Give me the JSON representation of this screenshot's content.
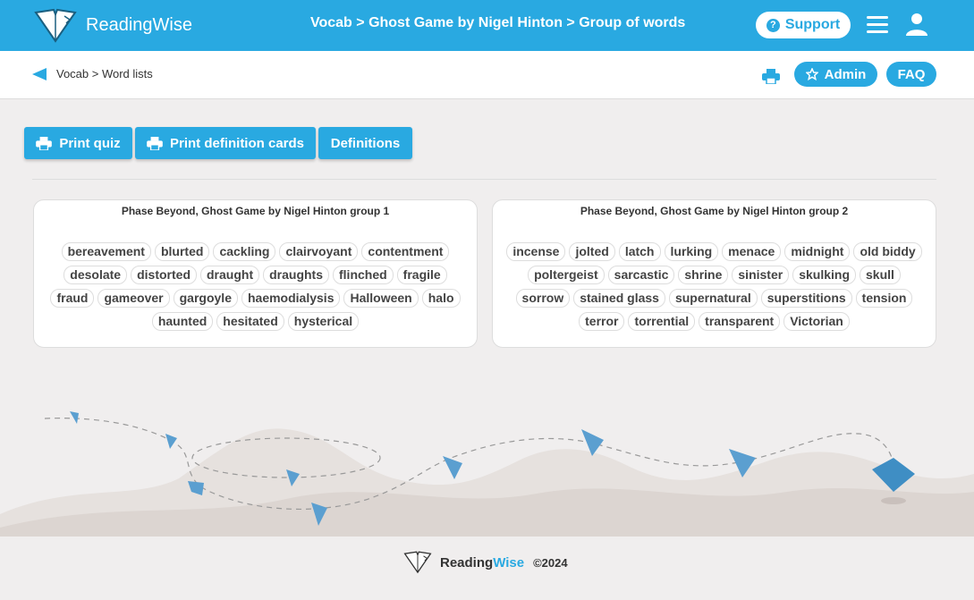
{
  "header": {
    "brand": "ReadingWise",
    "breadcrumb": "Vocab > Ghost Game by Nigel Hinton > Group of words",
    "support_label": "Support"
  },
  "subbar": {
    "breadcrumb": "Vocab > Word lists",
    "admin_label": "Admin",
    "faq_label": "FAQ"
  },
  "actions": {
    "print_quiz": "Print quiz",
    "print_cards": "Print definition cards",
    "definitions": "Definitions"
  },
  "groups": [
    {
      "title": "Phase Beyond, Ghost Game by Nigel Hinton group 1",
      "words": [
        "bereavement",
        "blurted",
        "cackling",
        "clairvoyant",
        "contentment",
        "desolate",
        "distorted",
        "draught",
        "draughts",
        "flinched",
        "fragile",
        "fraud",
        "gameover",
        "gargoyle",
        "haemodialysis",
        "Halloween",
        "halo",
        "haunted",
        "hesitated",
        "hysterical"
      ]
    },
    {
      "title": "Phase Beyond, Ghost Game by Nigel Hinton group 2",
      "words": [
        "incense",
        "jolted",
        "latch",
        "lurking",
        "menace",
        "midnight",
        "old biddy",
        "poltergeist",
        "sarcastic",
        "shrine",
        "sinister",
        "skulking",
        "skull",
        "sorrow",
        "stained glass",
        "supernatural",
        "superstitions",
        "tension",
        "terror",
        "torrential",
        "transparent",
        "Victorian"
      ]
    }
  ],
  "footer": {
    "brand_a": "Reading",
    "brand_b": "Wise",
    "copyright": "©2024"
  },
  "colors": {
    "accent": "#29a9e1",
    "background": "#f0eeee"
  }
}
